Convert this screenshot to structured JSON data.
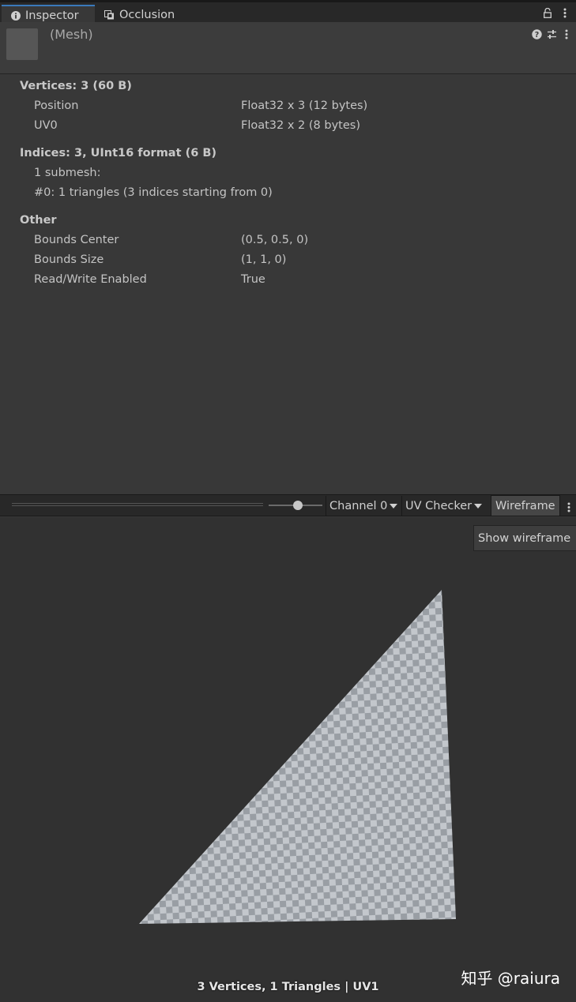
{
  "tabs": [
    {
      "label": "Inspector",
      "icon": "info-icon"
    },
    {
      "label": "Occlusion",
      "icon": "occlusion-icon"
    }
  ],
  "header": {
    "title": "(Mesh)"
  },
  "info": {
    "vertices": {
      "title": "Vertices: 3 (60 B)",
      "rows": [
        {
          "label": "Position",
          "value": "Float32 x 3 (12 bytes)"
        },
        {
          "label": "UV0",
          "value": "Float32 x 2 (8 bytes)"
        }
      ]
    },
    "indices": {
      "title": "Indices: 3, UInt16 format (6 B)",
      "lines": [
        "1 submesh:",
        "#0: 1 triangles (3 indices starting from 0)"
      ]
    },
    "other": {
      "title": "Other",
      "rows": [
        {
          "label": "Bounds Center",
          "value": "(0.5, 0.5, 0)"
        },
        {
          "label": "Bounds Size",
          "value": "(1, 1, 0)"
        },
        {
          "label": "Read/Write Enabled",
          "value": "True"
        }
      ]
    }
  },
  "toolbar": {
    "zoom_level": 0.55,
    "channel": "Channel 0",
    "view_mode": "UV Checker",
    "wireframe": "Wireframe"
  },
  "preview": {
    "show_wireframe": "Show wireframe",
    "stats": "3 Vertices, 1 Triangles | UV1",
    "watermark": "知乎 @raiura"
  },
  "colors": {
    "accent": "#3a79bb",
    "checker_light": "#c3c7cc",
    "checker_dark": "#999ea4"
  }
}
